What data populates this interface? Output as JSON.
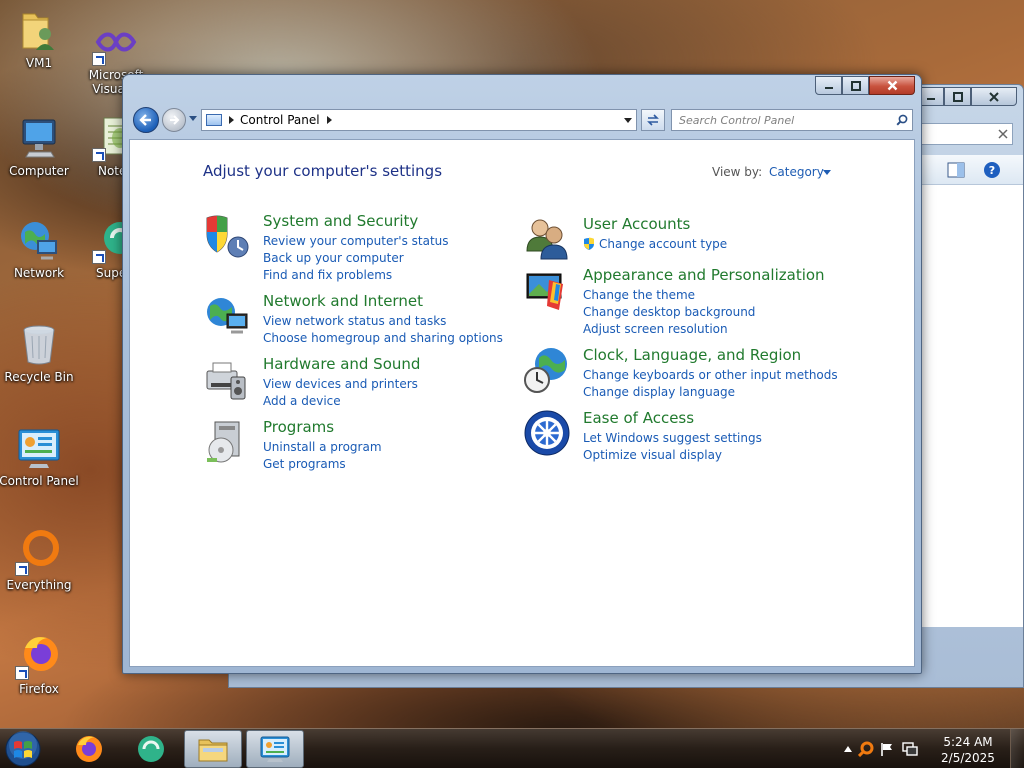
{
  "desktop": {
    "icons": [
      {
        "label": "VM1",
        "icon": "folder-user-icon"
      },
      {
        "label": "Microsoft Visual S",
        "icon": "visual-studio-icon"
      },
      {
        "label": "Computer",
        "icon": "computer-icon"
      },
      {
        "label": "Notep",
        "icon": "notepad-icon"
      },
      {
        "label": "Network",
        "icon": "network-icon"
      },
      {
        "label": "Superr",
        "icon": "app-icon"
      },
      {
        "label": "Recycle Bin",
        "icon": "recycle-bin-icon"
      },
      {
        "label": "Control Panel",
        "icon": "control-panel-icon"
      },
      {
        "label": "Everything",
        "icon": "everything-icon"
      },
      {
        "label": "Firefox",
        "icon": "firefox-icon"
      }
    ]
  },
  "window": {
    "address": {
      "crumb": "Control Panel"
    },
    "search_placeholder": "Search Control Panel",
    "heading": "Adjust your computer's settings",
    "view_by_label": "View by:",
    "view_by_value": "Category",
    "categories": [
      {
        "title": "System and Security",
        "icon": "system-security-icon",
        "links": [
          "Review your computer's status",
          "Back up your computer",
          "Find and fix problems"
        ]
      },
      {
        "title": "Network and Internet",
        "icon": "network-internet-icon",
        "links": [
          "View network status and tasks",
          "Choose homegroup and sharing options"
        ]
      },
      {
        "title": "Hardware and Sound",
        "icon": "hardware-sound-icon",
        "links": [
          "View devices and printers",
          "Add a device"
        ]
      },
      {
        "title": "Programs",
        "icon": "programs-icon",
        "links": [
          "Uninstall a program",
          "Get programs"
        ]
      },
      {
        "title": "User Accounts",
        "icon": "user-accounts-icon",
        "links": [
          "Change account type"
        ]
      },
      {
        "title": "Appearance and Personalization",
        "icon": "appearance-icon",
        "links": [
          "Change the theme",
          "Change desktop background",
          "Adjust screen resolution"
        ]
      },
      {
        "title": "Clock, Language, and Region",
        "icon": "clock-language-icon",
        "links": [
          "Change keyboards or other input methods",
          "Change display language"
        ]
      },
      {
        "title": "Ease of Access",
        "icon": "ease-of-access-icon",
        "links": [
          "Let Windows suggest settings",
          "Optimize visual display"
        ]
      }
    ]
  },
  "taskbar": {
    "clock_time": "5:24 AM",
    "clock_date": "2/5/2025"
  }
}
